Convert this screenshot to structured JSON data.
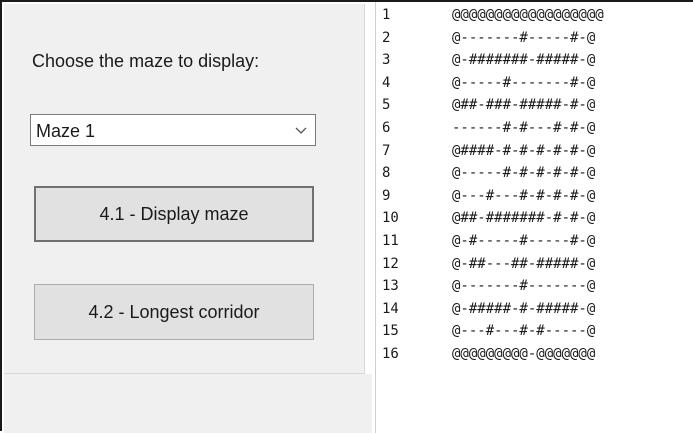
{
  "form": {
    "prompt": "Choose the maze to display:",
    "maze_select": {
      "value": "Maze 1",
      "icon": "chevron-down-icon"
    },
    "display_button": "4.1 - Display maze",
    "corridor_button": "4.2 - Longest corridor"
  },
  "maze_lines": [
    {
      "num": "1",
      "text": "@@@@@@@@@@@@@@@@@@"
    },
    {
      "num": "2",
      "text": "@-------#-----#-@"
    },
    {
      "num": "3",
      "text": "@-#######-#####-@"
    },
    {
      "num": "4",
      "text": "@-----#-------#-@"
    },
    {
      "num": "5",
      "text": "@##-###-#####-#-@"
    },
    {
      "num": "6",
      "text": "------#-#---#-#-@"
    },
    {
      "num": "7",
      "text": "@####-#-#-#-#-#-@"
    },
    {
      "num": "8",
      "text": "@-----#-#-#-#-#-@"
    },
    {
      "num": "9",
      "text": "@---#---#-#-#-#-@"
    },
    {
      "num": "10",
      "text": "@##-#######-#-#-@"
    },
    {
      "num": "11",
      "text": "@-#-----#-----#-@"
    },
    {
      "num": "12",
      "text": "@-##---##-#####-@"
    },
    {
      "num": "13",
      "text": "@-------#-------@"
    },
    {
      "num": "14",
      "text": "@-#####-#-#####-@"
    },
    {
      "num": "15",
      "text": "@---#---#-#-----@"
    },
    {
      "num": "16",
      "text": "@@@@@@@@@-@@@@@@@"
    }
  ]
}
